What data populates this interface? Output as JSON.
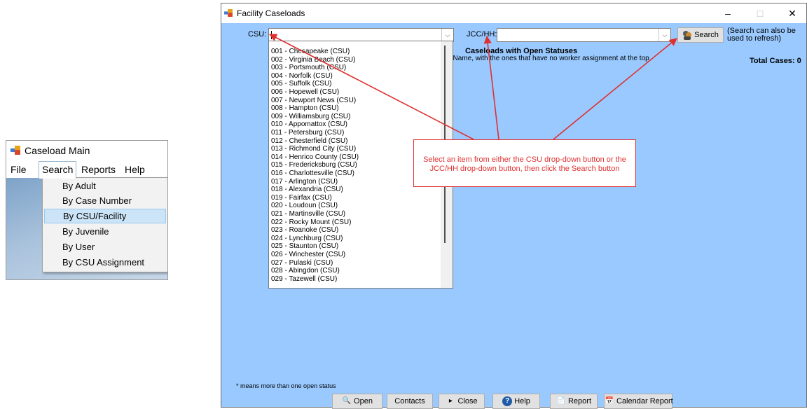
{
  "caseload_main": {
    "title": "Caseload Main",
    "menu": [
      "File",
      "Search",
      "Reports",
      "Help"
    ],
    "search_menu_items": [
      "By Adult",
      "By Case Number",
      "By CSU/Facility",
      "By Juvenile",
      "By User",
      "By CSU Assignment"
    ],
    "selected_item": "By CSU/Facility"
  },
  "facility_caseloads": {
    "title": "Facility Caseloads",
    "window_controls": {
      "minimize": "–",
      "maximize": "□",
      "close": "✕"
    },
    "csu_label": "CSU:",
    "csu_value": "",
    "jcc_label": "JCC/HH:",
    "jcc_value": "",
    "search_button": "Search",
    "search_note": "(Search can also be used to refresh)",
    "heading": "Caseloads with Open Statuses",
    "subheading_visible": "t Name, with the ones that have no worker assignment at the top.",
    "total_cases_label": "Total Cases: 0",
    "csu_options": [
      "001 - Chesapeake (CSU)",
      "002 - Virginia Beach (CSU)",
      "003 - Portsmouth (CSU)",
      "004 - Norfolk (CSU)",
      "005 - Suffolk (CSU)",
      "006 - Hopewell (CSU)",
      "007 - Newport News (CSU)",
      "008 - Hampton (CSU)",
      "009 - Williamsburg (CSU)",
      "010 - Appomattox (CSU)",
      "011 - Petersburg (CSU)",
      "012 - Chesterfield (CSU)",
      "013 - Richmond City (CSU)",
      "014 - Henrico County (CSU)",
      "015 - Fredericksburg (CSU)",
      "016 - Charlottesville (CSU)",
      "017 - Arlington (CSU)",
      "018 - Alexandria (CSU)",
      "019 - Fairfax (CSU)",
      "020 - Loudoun (CSU)",
      "021 - Martinsville (CSU)",
      "022 - Rocky Mount (CSU)",
      "023 - Roanoke (CSU)",
      "024 - Lynchburg (CSU)",
      "025 - Staunton (CSU)",
      "026 - Winchester (CSU)",
      "027 - Pulaski (CSU)",
      "028 - Abingdon (CSU)",
      "029 - Tazewell (CSU)"
    ],
    "callout": "Select an item from either the CSU drop-down button or the JCC/HH drop-down button, then click the Search button",
    "footnote": "* means more than one open status",
    "bottom_buttons": {
      "open": "Open",
      "contacts": "Contacts",
      "close": "Close",
      "help": "Help",
      "report": "Report",
      "calendar_report": "Calendar Report"
    }
  },
  "colors": {
    "window_bg": "#99c9ff",
    "annotation": "#e03030",
    "selection": "#cce4f7"
  }
}
